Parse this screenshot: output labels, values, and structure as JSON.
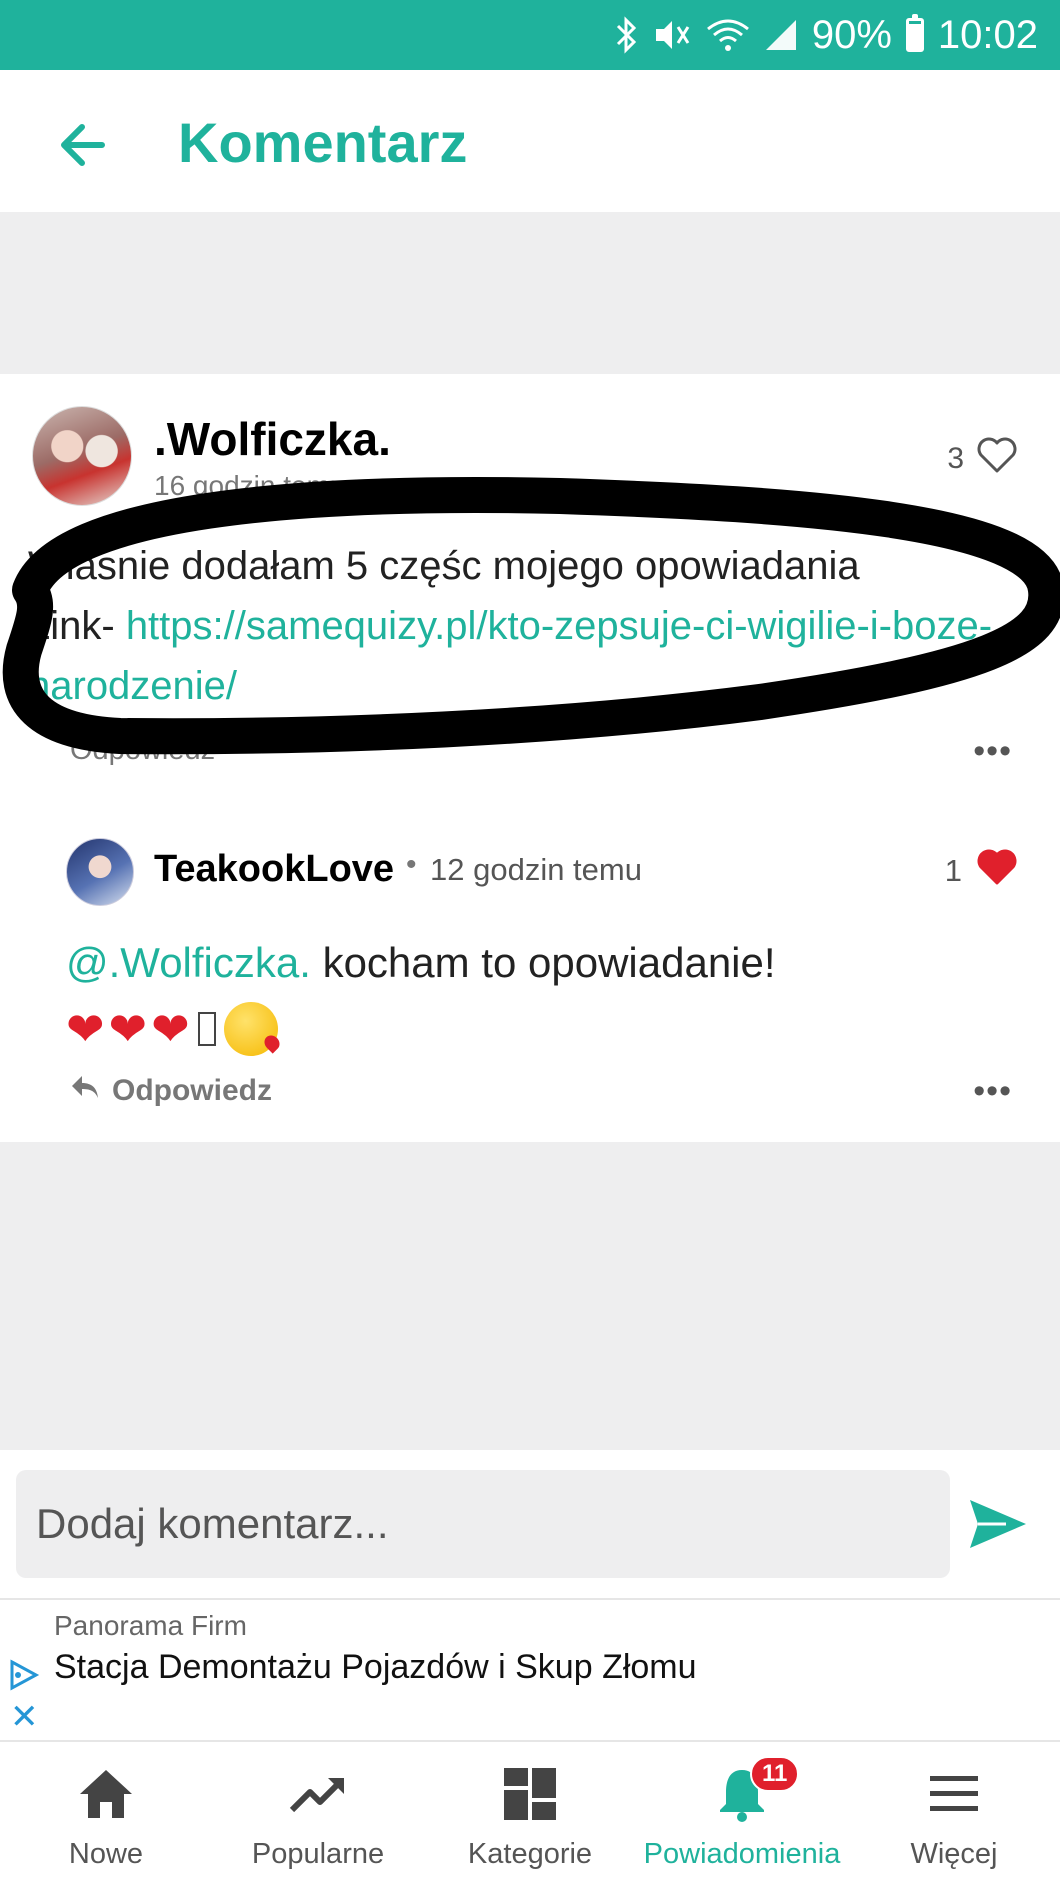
{
  "status_bar": {
    "battery": "90%",
    "battery_level": 0.9,
    "time": "10:02",
    "icons": [
      "bluetooth-icon",
      "mute-vibrate-icon",
      "wifi-icon",
      "signal-icon",
      "battery-icon"
    ]
  },
  "header": {
    "title": "Komentarz"
  },
  "comment": {
    "author": ".Wolficzka.",
    "time": "16 godzin temu",
    "likes": "3",
    "text_line1": "Własnie dodałam 5 częśc mojego opowiadania",
    "link_prefix": "Link- ",
    "link": "https://samequizy.pl/kto-zepsuje-ci-wigilie-i-boze-narodzenie/",
    "reply_label": "Odpowiedz",
    "more": "•••"
  },
  "reply": {
    "author": "TeakookLove",
    "separator": "•",
    "time": "12 godzin temu",
    "likes": "1",
    "mention": "@.Wolficzka.",
    "text": " kocham to opowiadanie!",
    "reply_label": "Odpowiedz",
    "more": "•••"
  },
  "composer": {
    "placeholder": "Dodaj komentarz..."
  },
  "ad": {
    "source": "Panorama Firm",
    "title": "Stacja Demontażu Pojazdów i Skup Złomu"
  },
  "nav": {
    "items": [
      {
        "label": "Nowe",
        "icon": "home-icon"
      },
      {
        "label": "Popularne",
        "icon": "trending-icon"
      },
      {
        "label": "Kategorie",
        "icon": "grid-icon"
      },
      {
        "label": "Powiadomienia",
        "icon": "bell-icon",
        "badge": "11"
      },
      {
        "label": "Więcej",
        "icon": "menu-icon"
      }
    ]
  },
  "colors": {
    "accent": "#1fb29c",
    "like_red": "#e0202c",
    "bg_gray": "#eeeeef"
  }
}
